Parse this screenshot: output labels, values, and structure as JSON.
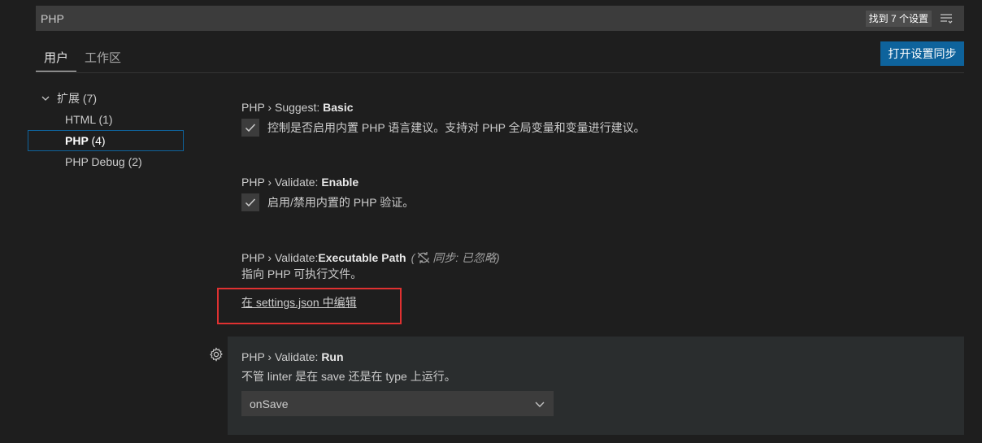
{
  "search": {
    "value": "PHP",
    "result_count": "找到 7 个设置"
  },
  "tabs": [
    {
      "label": "用户"
    },
    {
      "label": "工作区"
    }
  ],
  "sync_button_label": "打开设置同步",
  "toc": {
    "group_label": "扩展",
    "group_count": "(7)",
    "items": [
      {
        "label": "HTML",
        "count": "(1)"
      },
      {
        "label": "PHP",
        "count": "(4)"
      },
      {
        "label": "PHP Debug",
        "count": "(2)"
      }
    ]
  },
  "settings": [
    {
      "prefix": "PHP › Suggest: ",
      "name": "Basic",
      "description": "控制是否启用内置 PHP 语言建议。支持对 PHP 全局变量和变量进行建议。",
      "checked": true
    },
    {
      "prefix": "PHP › Validate: ",
      "name": "Enable",
      "description": "启用/禁用内置的 PHP 验证。",
      "checked": true
    },
    {
      "prefix": "PHP › Validate: ",
      "name": "Executable Path",
      "sync_note": "同步: 已忽略",
      "description": "指向 PHP 可执行文件。",
      "link": "在 settings.json 中编辑"
    },
    {
      "prefix": "PHP › Validate: ",
      "name": "Run",
      "description": "不管 linter 是在 save 还是在 type 上运行。",
      "select_value": "onSave"
    }
  ],
  "icons": {
    "filter": "filter-icon",
    "chevron": "chevron-down-icon",
    "check": "check-icon",
    "sync_ignored": "sync-ignored-icon",
    "gear": "gear-icon"
  },
  "colors": {
    "accent": "#0e639c",
    "highlight": "#e03131",
    "background": "#1e1e1e"
  }
}
